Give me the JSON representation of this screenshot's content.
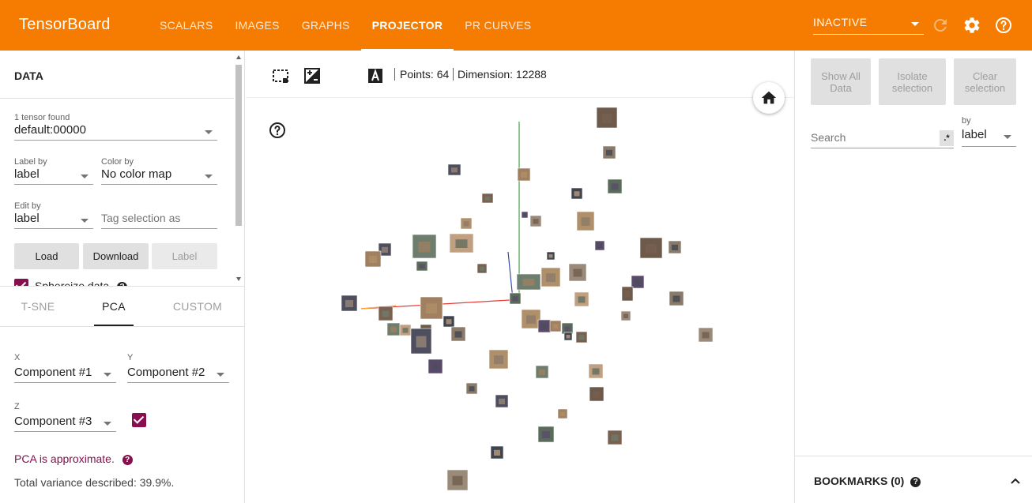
{
  "header": {
    "brand": "TensorBoard",
    "tabs": [
      {
        "label": "SCALARS",
        "active": false
      },
      {
        "label": "IMAGES",
        "active": false
      },
      {
        "label": "GRAPHS",
        "active": false
      },
      {
        "label": "PROJECTOR",
        "active": true
      },
      {
        "label": "PR CURVES",
        "active": false
      }
    ],
    "run_select": "INACTIVE",
    "icons": [
      "refresh-icon",
      "settings-icon",
      "help-icon"
    ],
    "colors": {
      "bar": "#f57c00",
      "text": "#ffffff"
    }
  },
  "data_panel": {
    "title": "DATA",
    "tensor_count_label": "1 tensor found",
    "tensor_value": "default:00000",
    "label_by": {
      "label": "Label by",
      "value": "label"
    },
    "color_by": {
      "label": "Color by",
      "value": "No color map"
    },
    "edit_by": {
      "label": "Edit by",
      "value": "label"
    },
    "tag_placeholder": "Tag selection as",
    "buttons": {
      "load": "Load",
      "download": "Download",
      "label": "Label"
    },
    "sphereize_label": "Sphereize data",
    "sphereize_checked": true
  },
  "projection": {
    "tabs": [
      {
        "label": "T-SNE",
        "active": false
      },
      {
        "label": "PCA",
        "active": true
      },
      {
        "label": "CUSTOM",
        "active": false
      }
    ],
    "x": {
      "label": "X",
      "value": "Component #1"
    },
    "y": {
      "label": "Y",
      "value": "Component #2"
    },
    "z": {
      "label": "Z",
      "value": "Component #3",
      "enabled": true
    },
    "pca_note": "PCA is approximate.",
    "variance": "Total variance described: 39.9%."
  },
  "toolbar": {
    "icons": [
      "select-box-icon",
      "night-mode-icon",
      "contrast-icon",
      "label-toggle-icon"
    ],
    "points": "Points: 64",
    "dimension": "Dimension: 12288"
  },
  "inspector": {
    "buttons": {
      "show_all": "Show All Data",
      "isolate": "Isolate selection",
      "clear": "Clear selection"
    },
    "search_placeholder": "Search",
    "regex_label": ".*",
    "by_label": "by",
    "by_value": "label",
    "bookmarks": "BOOKMARKS (0)"
  },
  "scatter": {
    "point_count": 64,
    "axes_colors": {
      "x": "#e53935",
      "y": "#43a047",
      "z": "#3949ab"
    },
    "thumb_colors": [
      "#6d5a4a",
      "#8a7a6a",
      "#4e4e5e",
      "#a08060",
      "#5b6b5b",
      "#7a6050",
      "#3f4550",
      "#9a8a7a",
      "#b0906a",
      "#5a4a6a",
      "#6e7e6e",
      "#c0a080"
    ]
  }
}
